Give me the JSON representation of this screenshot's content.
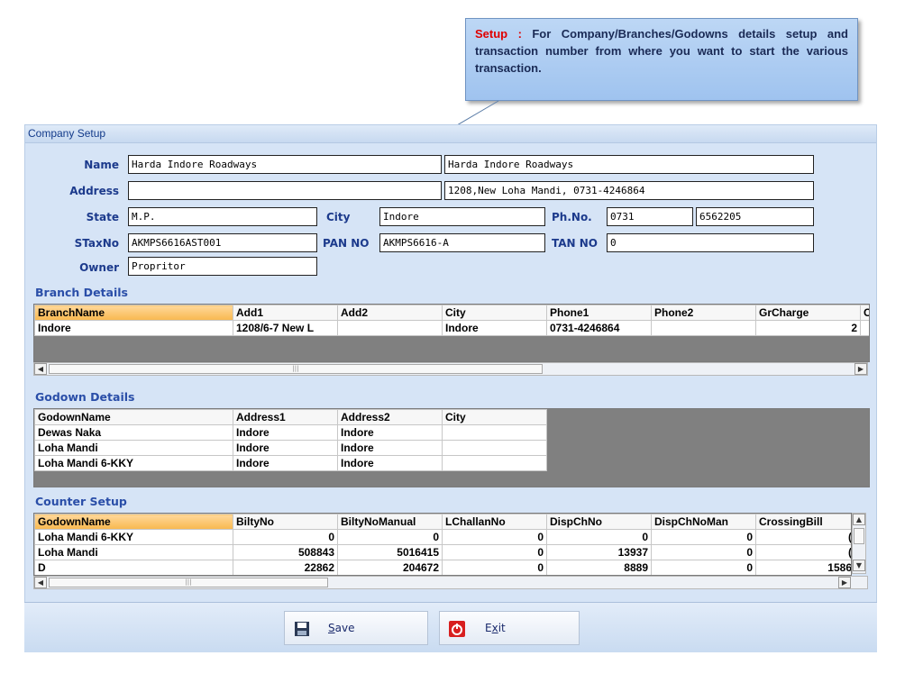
{
  "callout": {
    "keyword": "Setup",
    "separator": " : ",
    "text": "For Company/Branches/Godowns details setup and  transaction number from where you want to start the various transaction."
  },
  "window": {
    "title": "Company Setup"
  },
  "form": {
    "name_label": "Name",
    "name_value": "Harda Indore Roadways",
    "name_value2": "Harda Indore Roadways",
    "address_label": "Address",
    "address_value": "",
    "address_value2": "1208,New Loha Mandi, 0731-4246864",
    "state_label": "State",
    "state_value": "M.P.",
    "city_label": "City",
    "city_value": "Indore",
    "phone_label": "Ph.No.",
    "phone_value1": "0731",
    "phone_value2": "6562205",
    "staxno_label": "STaxNo",
    "staxno_value": "AKMPS6616AST001",
    "pan_label": "PAN NO",
    "pan_value": "AKMPS6616-A",
    "tan_label": "TAN NO",
    "tan_value": "0",
    "owner_label": "Owner",
    "owner_value": "Propritor"
  },
  "branch": {
    "title": "Branch Details",
    "headers": [
      "BranchName",
      "Add1",
      "Add2",
      "City",
      "Phone1",
      "Phone2",
      "GrCharge",
      "C"
    ],
    "rows": [
      [
        "Indore",
        "1208/6-7 New L",
        "",
        "Indore",
        "0731-4246864",
        "",
        "2",
        ""
      ]
    ]
  },
  "godown": {
    "title": "Godown Details",
    "headers": [
      "GodownName",
      "Address1",
      "Address2",
      "City"
    ],
    "rows": [
      [
        "Dewas Naka",
        "Indore",
        "Indore",
        ""
      ],
      [
        "Loha Mandi",
        "Indore",
        "Indore",
        ""
      ],
      [
        "Loha Mandi 6-KKY",
        "Indore",
        "Indore",
        ""
      ]
    ]
  },
  "counter": {
    "title": "Counter Setup",
    "headers": [
      "GodownName",
      "BiltyNo",
      "BiltyNoManual",
      "LChallanNo",
      "DispChNo",
      "DispChNoMan",
      "CrossingBill"
    ],
    "rows": [
      [
        "Loha Mandi 6-KKY",
        "0",
        "0",
        "0",
        "0",
        "0",
        "("
      ],
      [
        "Loha Mandi",
        "508843",
        "5016415",
        "0",
        "13937",
        "0",
        "("
      ],
      [
        "D",
        "22862",
        "204672",
        "0",
        "8889",
        "0",
        "1586"
      ]
    ]
  },
  "buttons": {
    "save_mnemonic": "S",
    "save_rest": "ave",
    "exit_pre": "E",
    "exit_mnemonic": "x",
    "exit_rest": "it"
  },
  "colors": {
    "label": "#1c3a8c",
    "section": "#2a4ea8",
    "keyword": "#e00000",
    "selected_header": "#f8b84e"
  }
}
